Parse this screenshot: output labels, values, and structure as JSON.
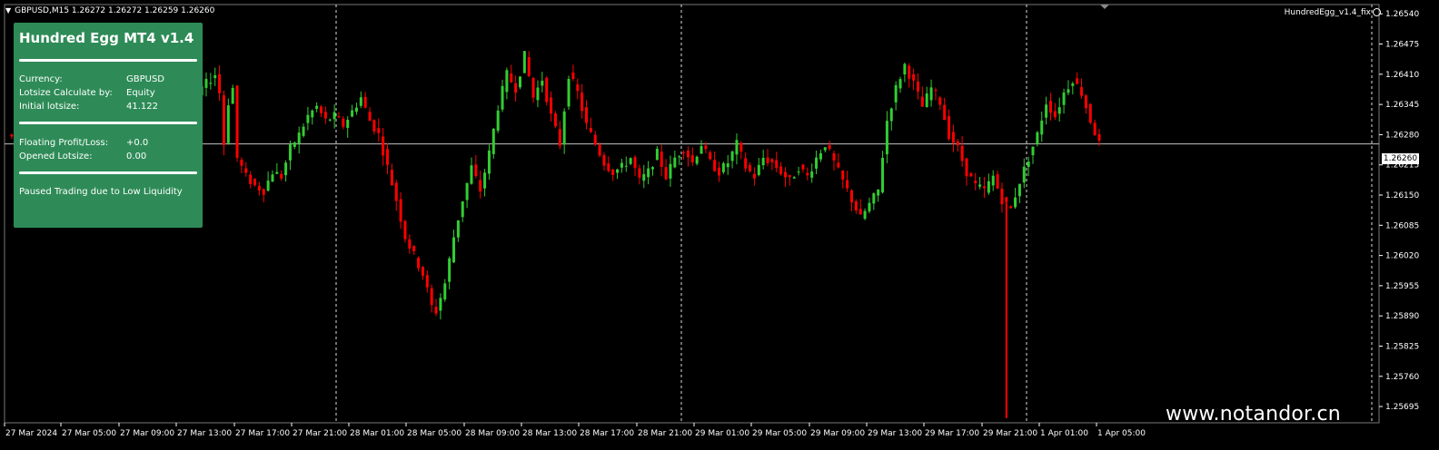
{
  "header": {
    "symbol_line": "GBPUSD,M15  1.26272 1.26272 1.26259 1.26260"
  },
  "ea_name": "HundredEgg_v1.4_fix",
  "panel": {
    "title": "Hundred Egg MT4 v1.4",
    "rows1": [
      {
        "label": "Currency:",
        "value": "GBPUSD"
      },
      {
        "label": "Lotsize Calculate by:",
        "value": "Equity"
      },
      {
        "label": "Initial lotsize:",
        "value": "41.122"
      }
    ],
    "rows2": [
      {
        "label": "Floating Profit/Loss:",
        "value": "+0.0"
      },
      {
        "label": "Opened Lotsize:",
        "value": "0.00"
      }
    ],
    "status": "Paused Trading due to Low Liquidity"
  },
  "watermark": "www.notandor.cn",
  "current_price": "1.26260",
  "colors": {
    "background": "#000000",
    "bull": "#32cd32",
    "bear": "#ff0000",
    "panel": "#2e8b57",
    "grid": "#ffffff"
  },
  "chart_data": {
    "type": "candlestick",
    "symbol": "GBPUSD",
    "timeframe": "M15",
    "ylim": [
      1.2566,
      1.2656
    ],
    "y_ticks": [
      "1.26540",
      "1.26475",
      "1.26410",
      "1.26345",
      "1.26280",
      "1.26215",
      "1.26150",
      "1.26085",
      "1.26020",
      "1.25955",
      "1.25890",
      "1.25825",
      "1.25760",
      "1.25695"
    ],
    "x_ticks": [
      "27 Mar 2024",
      "27 Mar 05:00",
      "27 Mar 09:00",
      "27 Mar 13:00",
      "27 Mar 17:00",
      "27 Mar 21:00",
      "28 Mar 01:00",
      "28 Mar 05:00",
      "28 Mar 09:00",
      "28 Mar 13:00",
      "28 Mar 17:00",
      "28 Mar 21:00",
      "29 Mar 01:00",
      "29 Mar 05:00",
      "29 Mar 09:00",
      "29 Mar 13:00",
      "29 Mar 17:00",
      "29 Mar 21:00",
      "1 Apr 01:00",
      "1 Apr 05:00"
    ],
    "session_separators": [
      "28 Mar 00:00",
      "29 Mar 00:00",
      "1 Apr 00:00"
    ],
    "current_price": 1.2626,
    "close_path": [
      [
        0,
        1.2628
      ],
      [
        2,
        1.2627
      ],
      [
        4,
        1.2624
      ],
      [
        6,
        1.262
      ],
      [
        8,
        1.2616
      ],
      [
        10,
        1.2614
      ],
      [
        12,
        1.2618
      ],
      [
        14,
        1.2616
      ],
      [
        16,
        1.2613
      ],
      [
        18,
        1.2616
      ],
      [
        20,
        1.262
      ],
      [
        22,
        1.2615
      ],
      [
        24,
        1.2612
      ],
      [
        26,
        1.2616
      ],
      [
        28,
        1.2622
      ],
      [
        30,
        1.2626
      ],
      [
        32,
        1.2629
      ],
      [
        34,
        1.2624
      ],
      [
        36,
        1.263
      ],
      [
        38,
        1.2633
      ],
      [
        40,
        1.2631
      ],
      [
        42,
        1.2635
      ],
      [
        44,
        1.2638
      ],
      [
        46,
        1.264
      ],
      [
        47,
        1.2641
      ],
      [
        48,
        1.2637
      ],
      [
        49,
        1.2626
      ],
      [
        50,
        1.2635
      ],
      [
        51,
        1.2638
      ],
      [
        52,
        1.2623
      ],
      [
        54,
        1.2619
      ],
      [
        56,
        1.2617
      ],
      [
        58,
        1.2616
      ],
      [
        60,
        1.262
      ],
      [
        62,
        1.2619
      ],
      [
        64,
        1.2625
      ],
      [
        66,
        1.2628
      ],
      [
        68,
        1.2632
      ],
      [
        70,
        1.2634
      ],
      [
        72,
        1.2631
      ],
      [
        74,
        1.2632
      ],
      [
        76,
        1.263
      ],
      [
        78,
        1.2633
      ],
      [
        80,
        1.2636
      ],
      [
        82,
        1.2631
      ],
      [
        84,
        1.2628
      ],
      [
        86,
        1.2621
      ],
      [
        88,
        1.2614
      ],
      [
        90,
        1.2606
      ],
      [
        92,
        1.2602
      ],
      [
        94,
        1.2598
      ],
      [
        96,
        1.2591
      ],
      [
        97,
        1.259
      ],
      [
        99,
        1.2596
      ],
      [
        101,
        1.2606
      ],
      [
        103,
        1.2614
      ],
      [
        105,
        1.2621
      ],
      [
        107,
        1.2616
      ],
      [
        109,
        1.2624
      ],
      [
        111,
        1.2634
      ],
      [
        113,
        1.2641
      ],
      [
        115,
        1.2638
      ],
      [
        117,
        1.2645
      ],
      [
        119,
        1.2636
      ],
      [
        121,
        1.264
      ],
      [
        123,
        1.2632
      ],
      [
        125,
        1.2626
      ],
      [
        127,
        1.2641
      ],
      [
        129,
        1.2637
      ],
      [
        131,
        1.263
      ],
      [
        133,
        1.2626
      ],
      [
        135,
        1.2622
      ],
      [
        137,
        1.262
      ],
      [
        139,
        1.2621
      ],
      [
        141,
        1.2623
      ],
      [
        143,
        1.2618
      ],
      [
        145,
        1.262
      ],
      [
        147,
        1.2624
      ],
      [
        149,
        1.2619
      ],
      [
        151,
        1.2623
      ],
      [
        153,
        1.2625
      ],
      [
        155,
        1.2622
      ],
      [
        157,
        1.2626
      ],
      [
        159,
        1.2622
      ],
      [
        161,
        1.262
      ],
      [
        163,
        1.2622
      ],
      [
        165,
        1.2626
      ],
      [
        167,
        1.2621
      ],
      [
        169,
        1.2619
      ],
      [
        171,
        1.2623
      ],
      [
        173,
        1.2622
      ],
      [
        175,
        1.262
      ],
      [
        177,
        1.2618
      ],
      [
        179,
        1.2621
      ],
      [
        181,
        1.2619
      ],
      [
        183,
        1.2623
      ],
      [
        185,
        1.2626
      ],
      [
        187,
        1.2622
      ],
      [
        189,
        1.2618
      ],
      [
        191,
        1.2614
      ],
      [
        193,
        1.261
      ],
      [
        195,
        1.2613
      ],
      [
        197,
        1.2616
      ],
      [
        199,
        1.2631
      ],
      [
        201,
        1.2638
      ],
      [
        203,
        1.2643
      ],
      [
        205,
        1.2639
      ],
      [
        207,
        1.2634
      ],
      [
        209,
        1.2638
      ],
      [
        211,
        1.2635
      ],
      [
        213,
        1.2628
      ],
      [
        215,
        1.2625
      ],
      [
        217,
        1.262
      ],
      [
        219,
        1.2617
      ],
      [
        221,
        1.2616
      ],
      [
        223,
        1.2619
      ],
      [
        225,
        1.2614
      ],
      [
        227,
        1.2612
      ],
      [
        229,
        1.2618
      ],
      [
        231,
        1.2623
      ],
      [
        233,
        1.2628
      ],
      [
        235,
        1.2635
      ],
      [
        237,
        1.2632
      ],
      [
        239,
        1.2637
      ],
      [
        241,
        1.264
      ],
      [
        243,
        1.2637
      ],
      [
        245,
        1.2631
      ],
      [
        247,
        1.2626
      ]
    ],
    "spike": {
      "index": 226,
      "low": 1.2567
    }
  }
}
